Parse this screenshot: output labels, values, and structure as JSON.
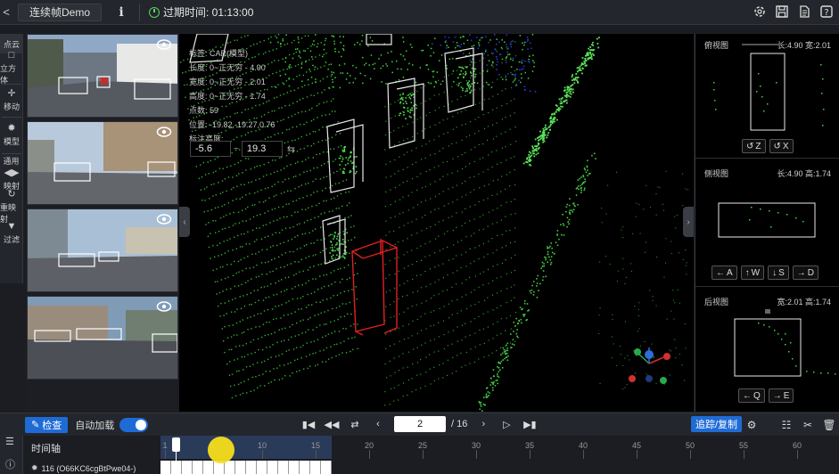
{
  "topbar": {
    "title": "连续帧Demo",
    "info_icon": "info-icon",
    "timer_label": "过期时间: 01:13:00"
  },
  "lefttools": {
    "items": [
      {
        "label": "点云",
        "icon": "point-cloud-icon"
      },
      {
        "label": "立方体",
        "icon": "cube-icon"
      },
      {
        "label": "移动",
        "icon": "move-icon"
      },
      {
        "label": "模型",
        "icon": "model-icon"
      },
      {
        "label": "通用",
        "icon": ""
      },
      {
        "label": "映射",
        "icon": "mapping-icon"
      },
      {
        "label": "重映射",
        "icon": "remap-icon"
      },
      {
        "label": "过滤",
        "icon": "filter-icon"
      }
    ]
  },
  "annotation": {
    "label": "标签: CAR(模型)",
    "length": "长度: 0~正无穷 - 4.90",
    "width": "宽度: 0~正无穷 - 2.01",
    "height": "高度: 0~正无穷 - 1.74",
    "points": "点数: 59",
    "position": "位置: -19.82,-19.27,0.76",
    "height_label": "标注高度:",
    "height_min": "-5.6",
    "height_max": "19.3",
    "range_sep": "~"
  },
  "views": {
    "top": {
      "title": "俯视图",
      "dims": "长:4.90 宽:2.01",
      "buttons": [
        "Z",
        "X"
      ]
    },
    "side": {
      "title": "侧视图",
      "dims": "长:4.90 高:1.74",
      "buttons": [
        "A",
        "W",
        "S",
        "D"
      ]
    },
    "back": {
      "title": "后视图",
      "dims": "宽:2.01 高:1.74",
      "buttons": [
        "Q",
        "E"
      ]
    }
  },
  "bottombar": {
    "check_label": "检查",
    "autoload_label": "自动加载",
    "autoload_on": true,
    "frame_current": "2",
    "frame_total": "/ 16",
    "track_label": "追踪/复制"
  },
  "timeline": {
    "label": "时间轴",
    "track_label": "116 (O66KC6cgBtPwe04-)",
    "ticks": [
      "1",
      "5",
      "10",
      "15",
      "20",
      "25",
      "30",
      "35",
      "40",
      "45",
      "50",
      "55",
      "60"
    ],
    "total_frames": 16,
    "current_frame": 2
  },
  "colors": {
    "accent": "#1f6bd6",
    "points": "#3fd43f",
    "selected_box": "#e02020"
  }
}
